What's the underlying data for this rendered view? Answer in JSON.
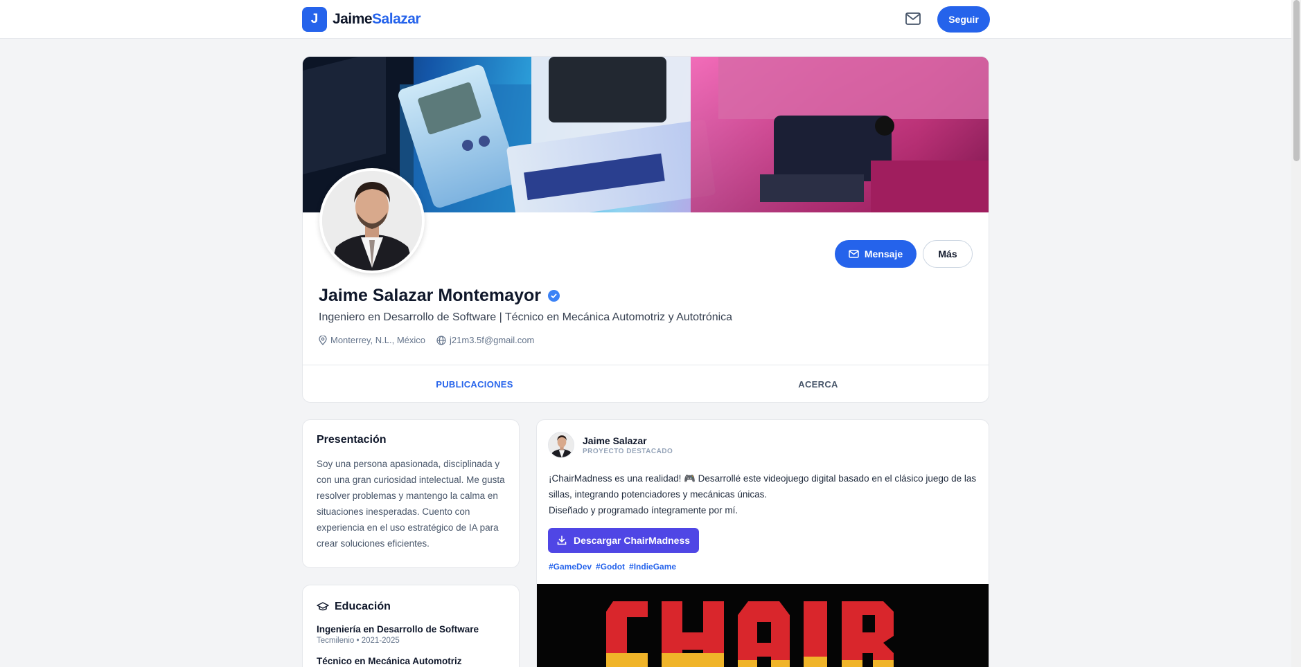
{
  "navbar": {
    "logo_letter": "J",
    "logo_first": "Jaime",
    "logo_last": "Salazar",
    "follow_label": "Seguir"
  },
  "profile": {
    "name": "Jaime Salazar Montemayor",
    "headline": "Ingeniero en Desarrollo de Software | Técnico en Mecánica Automotriz y Autotrónica",
    "location": "Monterrey, N.L., México",
    "email": "j21m3.5f@gmail.com",
    "message_label": "Mensaje",
    "more_label": "Más"
  },
  "tabs": [
    {
      "label": "PUBLICACIONES",
      "active": true
    },
    {
      "label": "ACERCA",
      "active": false
    }
  ],
  "intro": {
    "title": "Presentación",
    "text": "Soy una persona apasionada, disciplinada y con una gran curiosidad intelectual. Me gusta resolver problemas y mantengo la calma en situaciones inesperadas. Cuento con experiencia en el uso estratégico de IA para crear soluciones eficientes."
  },
  "education": {
    "title": "Educación",
    "items": [
      {
        "degree": "Ingeniería en Desarrollo de Software",
        "detail": "Tecmilenio • 2021-2025"
      },
      {
        "degree": "Técnico en Mecánica Automotriz",
        "detail": ""
      }
    ]
  },
  "post": {
    "author": "Jaime Salazar",
    "tag": "PROYECTO DESTACADO",
    "line1": "¡ChairMadness es una realidad! 🎮 Desarrollé este videojuego digital basado en el clásico juego de las sillas, integrando potenciadores y mecánicas únicas.",
    "line2": "Diseñado y programado íntegramente por mí.",
    "download_label": "Descargar ChairMadness",
    "hashtags": [
      "#GameDev",
      "#Godot",
      "#IndieGame"
    ]
  },
  "colors": {
    "accent": "#2563eb",
    "download": "#4f46e5",
    "background": "#f3f4f6"
  },
  "icons": [
    "mail-icon",
    "verified-badge-icon",
    "map-pin-icon",
    "globe-icon",
    "graduation-cap-icon",
    "download-icon"
  ]
}
